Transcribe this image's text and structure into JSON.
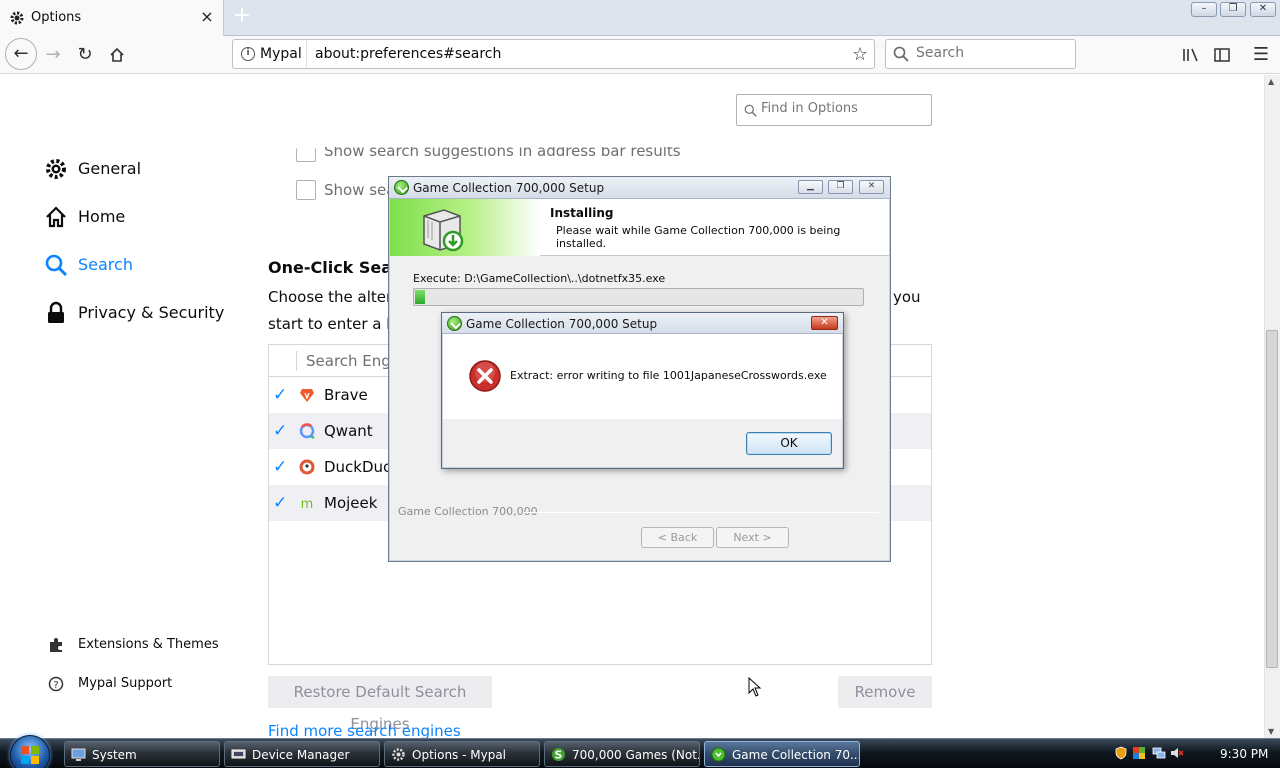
{
  "browser": {
    "tab_title": "Options",
    "new_tab": "+",
    "url_site": "Mypal",
    "url": "about:preferences#search",
    "search_placeholder": "Search",
    "window_controls": [
      "–",
      "❐",
      "✕"
    ]
  },
  "preferences": {
    "find_placeholder": "Find in Options",
    "categories": [
      {
        "label": "General",
        "icon": "gear-icon"
      },
      {
        "label": "Home",
        "icon": "home-icon"
      },
      {
        "label": "Search",
        "icon": "search-icon",
        "selected": true
      },
      {
        "label": "Privacy & Security",
        "icon": "lock-icon"
      }
    ],
    "footer_links": [
      {
        "label": "Extensions & Themes",
        "icon": "puzzle-icon"
      },
      {
        "label": "Mypal Support",
        "icon": "help-icon"
      }
    ],
    "option_suggestions_address": "Show search suggestions in address bar results",
    "option_show_search": "Show sear",
    "one_click_heading": "One-Click Searc",
    "one_click_desc_line1_start": "Choose the alterna",
    "one_click_desc_line1_end": "you",
    "one_click_desc_line2": "start to enter a key",
    "engine_column": "Search Engin",
    "engines": [
      {
        "name": "Brave",
        "checked": true,
        "icon": "brave-icon"
      },
      {
        "name": "Qwant",
        "checked": true,
        "icon": "qwant-icon"
      },
      {
        "name": "DuckDuck",
        "checked": true,
        "icon": "duckduckgo-icon"
      },
      {
        "name": "Mojeek",
        "checked": true,
        "icon": "mojeek-icon"
      }
    ],
    "restore_button": "Restore Default Search Engines",
    "remove_button": "Remove",
    "find_more_link": "Find more search engines"
  },
  "installer": {
    "title": "Game Collection 700,000 Setup",
    "heading": "Installing",
    "subheading": "Please wait while Game Collection 700,000 is being installed.",
    "execute_text": "Execute: D:\\GameCollection\\..\\dotnetfx35.exe",
    "progress": 0.02,
    "brand": "Game Collection 700,000",
    "back_button": "< Back",
    "next_button": "Next >"
  },
  "error_dialog": {
    "title": "Game Collection 700,000 Setup",
    "message": "Extract: error writing to file 1001JapaneseCrosswords.exe",
    "ok_button": "OK",
    "close": "✕"
  },
  "taskbar": {
    "items": [
      {
        "label": "System",
        "icon": "system-icon"
      },
      {
        "label": "Device Manager",
        "icon": "device-manager-icon"
      },
      {
        "label": "Options - Mypal",
        "icon": "mypal-icon"
      },
      {
        "label": "700,000 Games (Not...",
        "icon": "games-icon"
      },
      {
        "label": "Game Collection 70...",
        "icon": "setup-icon",
        "active": true
      }
    ],
    "clock": "9:30 PM"
  },
  "colors": {
    "accent": "#0a84ff",
    "progress_green": "#2ea82a",
    "error_red": "#c8391c"
  }
}
